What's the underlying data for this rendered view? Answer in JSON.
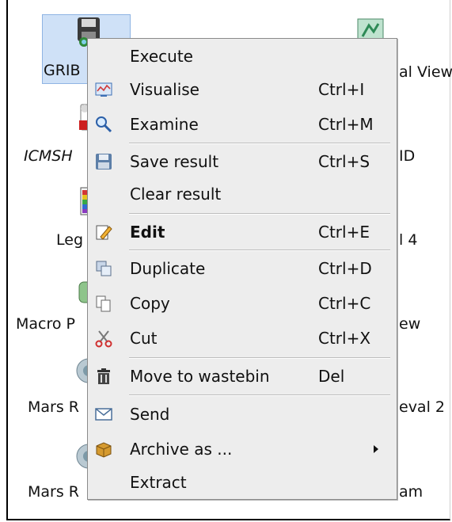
{
  "desktop": {
    "icons": [
      {
        "label": "GRIB",
        "name": "grib"
      },
      {
        "label": "ICMSH",
        "name": "icmsh"
      },
      {
        "label": "Leg",
        "name": "legend"
      },
      {
        "label": "Macro P",
        "name": "macro"
      },
      {
        "label": "Mars R",
        "name": "mars-1"
      },
      {
        "label": "Mars R",
        "name": "mars-2"
      }
    ],
    "right_labels": [
      "al View",
      "ID",
      "l 4",
      "ew",
      "eval 2",
      "am"
    ]
  },
  "context_menu": {
    "items": [
      {
        "label": "Execute",
        "shortcut": "",
        "icon": ""
      },
      {
        "label": "Visualise",
        "shortcut": "Ctrl+I",
        "icon": "visualise-icon"
      },
      {
        "label": "Examine",
        "shortcut": "Ctrl+M",
        "icon": "magnifier-icon"
      },
      {
        "label": "Save result",
        "shortcut": "Ctrl+S",
        "icon": "floppy-disk-icon"
      },
      {
        "label": "Clear result",
        "shortcut": "",
        "icon": ""
      },
      {
        "label": "Edit",
        "shortcut": "Ctrl+E",
        "icon": "pencil-icon"
      },
      {
        "label": "Duplicate",
        "shortcut": "Ctrl+D",
        "icon": "duplicate-icon"
      },
      {
        "label": "Copy",
        "shortcut": "Ctrl+C",
        "icon": "copy-icon"
      },
      {
        "label": "Cut",
        "shortcut": "Ctrl+X",
        "icon": "scissors-icon"
      },
      {
        "label": "Move to wastebin",
        "shortcut": "Del",
        "icon": "trash-icon"
      },
      {
        "label": "Send",
        "shortcut": "",
        "icon": "envelope-icon"
      },
      {
        "label": "Archive as ...",
        "shortcut": "",
        "icon": "archive-box-icon",
        "submenu": true
      },
      {
        "label": "Extract",
        "shortcut": "",
        "icon": ""
      }
    ]
  },
  "colors": {
    "selection": "#cfe1f7",
    "menu_bg": "#ededed",
    "menu_border": "#8a8a8a"
  }
}
